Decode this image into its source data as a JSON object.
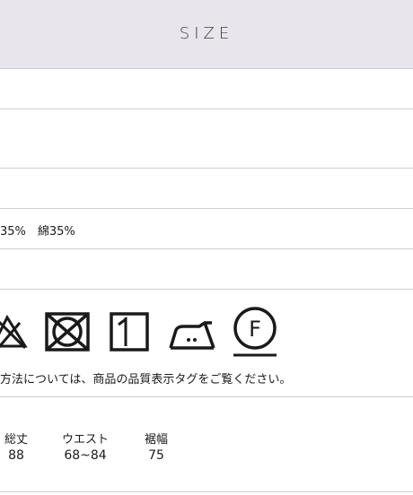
{
  "header": {
    "title": "SIZE"
  },
  "material": {
    "text": "35%　綿35%"
  },
  "care": {
    "icons": [
      "no-bleach-icon",
      "no-tumble-dry-icon",
      "line-dry-icon",
      "iron-low-icon",
      "dry-clean-f-icon"
    ],
    "note": "方法については、商品の品質表示タグをご覧ください。"
  },
  "size_table": {
    "headers": [
      "総丈",
      "ウエスト",
      "裾幅"
    ],
    "values": [
      "88",
      "68~84",
      "75"
    ]
  }
}
